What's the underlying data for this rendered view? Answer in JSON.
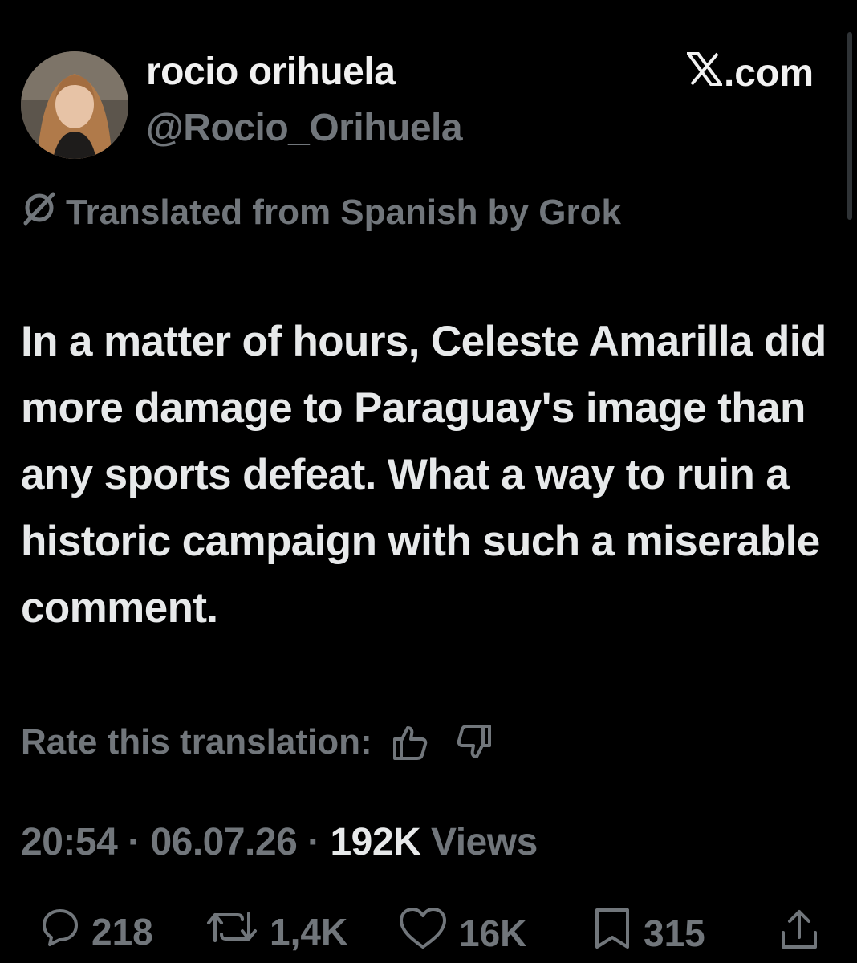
{
  "author": {
    "name": "rocio orihuela",
    "handle": "@Rocio_Orihuela"
  },
  "brand": {
    "label": ".com",
    "logo_icon": "x-logo-icon"
  },
  "translation": {
    "notice": "Translated from Spanish by Grok",
    "rate_label": "Rate this translation:"
  },
  "tweet": {
    "text": "In a matter of hours, Celeste Amarilla did more damage to Paraguay's image than any sports defeat. What a way to ruin a historic campaign with such a miserable comment."
  },
  "meta": {
    "time": "20:54",
    "separator": "·",
    "date": "06.07.26",
    "views_count": "192K",
    "views_label": "Views"
  },
  "actions": {
    "replies": "218",
    "reposts": "1,4K",
    "likes": "16K",
    "bookmarks": "315"
  },
  "colors": {
    "background": "#000000",
    "primary_text": "#e7e9ea",
    "secondary_text": "#71767b"
  }
}
